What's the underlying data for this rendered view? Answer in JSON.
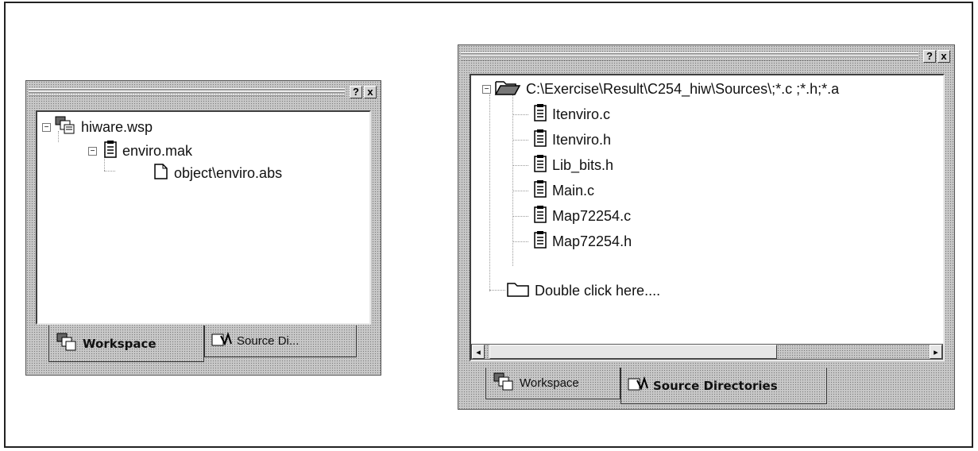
{
  "left_panel": {
    "title_buttons": [
      "?",
      "x"
    ],
    "tree": [
      {
        "label": "hiware.wsp",
        "icon": "workspace-icon",
        "expander": "−"
      },
      {
        "label": "enviro.mak",
        "icon": "document-icon",
        "expander": "−"
      },
      {
        "label": "object\\enviro.abs",
        "icon": "object-file-icon",
        "expander": ""
      }
    ],
    "tabs": [
      {
        "label": "Workspace",
        "icon": "workspace-icon",
        "active": true
      },
      {
        "label": "Source Di...",
        "icon": "source-directories-icon",
        "active": false
      }
    ]
  },
  "right_panel": {
    "title_buttons": [
      "?",
      "x"
    ],
    "root_path": "C:\\Exercise\\Result\\C254_hiw\\Sources\\;*.c ;*.h;*.a",
    "files": [
      "Itenviro.c",
      "Itenviro.h",
      "Lib_bits.h",
      "Main.c",
      "Map72254.c",
      "Map72254.h"
    ],
    "double_click_label": "Double click here....",
    "scroll_left": "◂",
    "scroll_right": "▸",
    "tabs": [
      {
        "label": "Workspace",
        "icon": "workspace-icon",
        "active": false
      },
      {
        "label": "Source Directories",
        "icon": "source-directories-icon",
        "active": true
      }
    ]
  }
}
